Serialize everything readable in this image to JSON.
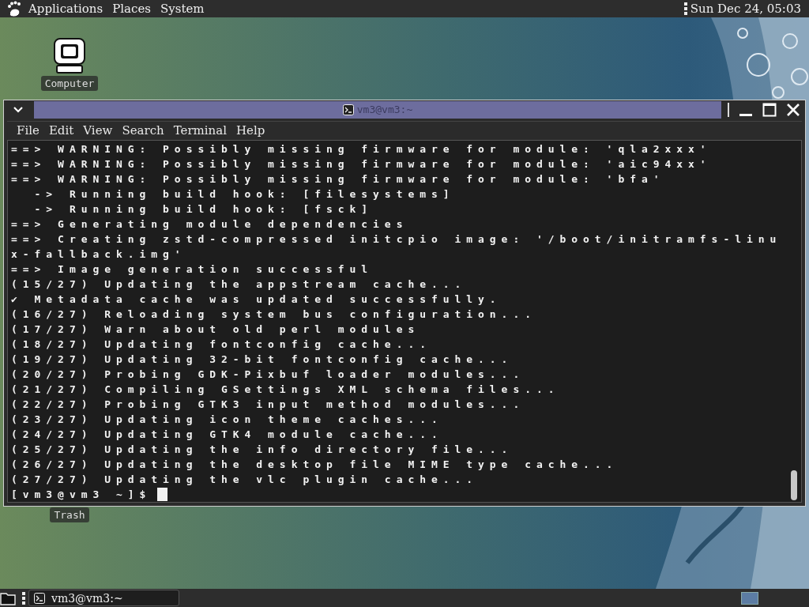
{
  "top_panel": {
    "menus": [
      "Applications",
      "Places",
      "System"
    ],
    "clock": "Sun Dec 24, 05:03"
  },
  "desktop_icons": [
    {
      "kind": "computer",
      "label": "Computer"
    },
    {
      "kind": "trash",
      "label": "Trash"
    }
  ],
  "terminal": {
    "title": "vm3@vm3:~",
    "menu": [
      "File",
      "Edit",
      "View",
      "Search",
      "Terminal",
      "Help"
    ],
    "lines": [
      "==> WARNING: Possibly missing firmware for module: 'qla2xxx'",
      "==> WARNING: Possibly missing firmware for module: 'aic94xx'",
      "==> WARNING: Possibly missing firmware for module: 'bfa'",
      "  -> Running build hook: [filesystems]",
      "  -> Running build hook: [fsck]",
      "==> Generating module dependencies",
      "==> Creating zstd-compressed initcpio image: '/boot/initramfs-linu",
      "x-fallback.img'",
      "==> Image generation successful",
      "(15/27) Updating the appstream cache...",
      "✔ Metadata cache was updated successfully.",
      "(16/27) Reloading system bus configuration...",
      "(17/27) Warn about old perl modules",
      "(18/27) Updating fontconfig cache...",
      "(19/27) Updating 32-bit fontconfig cache...",
      "(20/27) Probing GDK-Pixbuf loader modules...",
      "(21/27) Compiling GSettings XML schema files...",
      "(22/27) Probing GTK3 input method modules...",
      "(23/27) Updating icon theme caches...",
      "(24/27) Updating GTK4 module cache...",
      "(25/27) Updating the info directory file...",
      "(26/27) Updating the desktop file MIME type cache...",
      "(27/27) Updating the vlc plugin cache..."
    ],
    "prompt": "[vm3@vm3 ~]$"
  },
  "taskbar": {
    "tasks": [
      {
        "label": "vm3@vm3:~"
      }
    ]
  }
}
